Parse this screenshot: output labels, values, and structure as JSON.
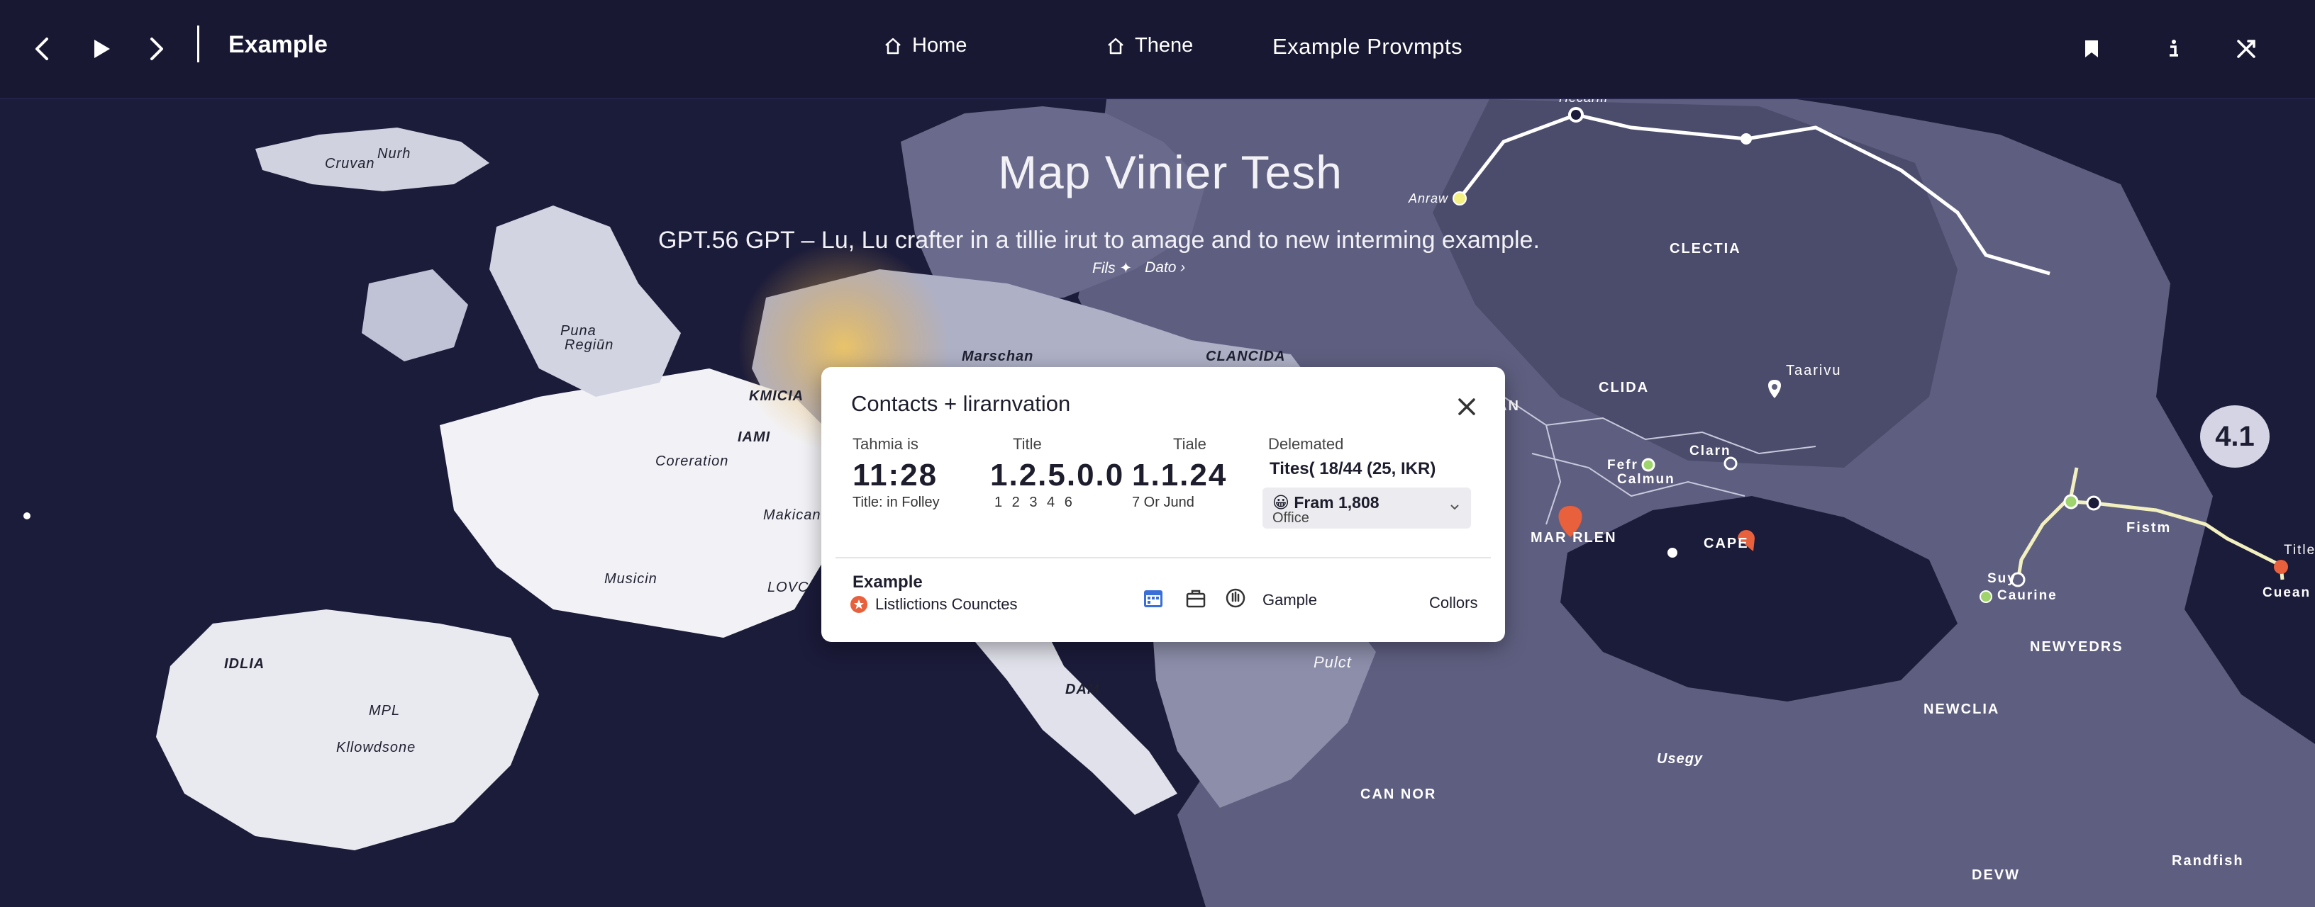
{
  "app": {
    "title": "Example",
    "nav": [
      {
        "label": "Home",
        "icon": "home-icon"
      },
      {
        "label": "Thene",
        "icon": "home-icon"
      },
      {
        "label": "Example Provmpts"
      }
    ],
    "toolbar_icons": [
      "back-arrow-icon",
      "play-icon",
      "forward-arrow-icon",
      "bookmark-icon",
      "info-icon",
      "expand-icon"
    ]
  },
  "map": {
    "title": "Map Vinier  Tesh",
    "subtitle": "GPT.56 GPT – Lu, Lu crafter in a tillie irut to amage and to new interming example.",
    "filters": [
      "Fils ✦",
      "Dato ›"
    ],
    "zoom_level": "4.1",
    "labels": [
      "Nurh",
      "Cruvan",
      "Puna",
      "Regiūn",
      "KMICIA",
      "IAMI",
      "Coreration",
      "Marschan",
      "Makican",
      "Musicin",
      "LOVC",
      "IDLIA",
      "MPL",
      "Kllowdsone",
      "CLANCIDA",
      "AN",
      "CLIDA",
      "CLECTIA",
      "Hecarm",
      "Anraw",
      "Taarivu",
      "Fefr",
      "Calmun",
      "Clarn",
      "MAR RLEN",
      "CAPE",
      "Pulct",
      "DAM",
      "CAN NOR",
      "Usegy",
      "NEWCLIA",
      "NEWYEDRS",
      "Fistm",
      "Suy",
      "Caurine",
      "Title",
      "Cuean",
      "Randfish",
      "DEVW"
    ],
    "colors": {
      "sea": "#1b1b3a",
      "land_light": "#e9eaf0",
      "land_dark": "#5c5c7e",
      "route": "#ffffff",
      "accent_pin": "#e8603c",
      "node_green": "#9fd36b"
    }
  },
  "card": {
    "title": "Contacts + lirarnvation",
    "columns": [
      {
        "header": "Tahmia is",
        "value": "11:28",
        "sub": "Title: in Folley"
      },
      {
        "header": "Title",
        "value": "1.2.5.0.0",
        "sub": "1  2  3  4  6"
      },
      {
        "header": "Tiale",
        "value": "1.1.24",
        "sub": "7  Or  Jund"
      }
    ],
    "delemated": {
      "header": "Delemated",
      "info": "Tites( 18/44 (25,   IKR)",
      "select_value": "😀 Fram 1,808",
      "select_sub": "Office"
    },
    "footer": {
      "label": "Example",
      "link": "Listlictions Counctes",
      "text": "Gample",
      "right": "Collors"
    }
  }
}
